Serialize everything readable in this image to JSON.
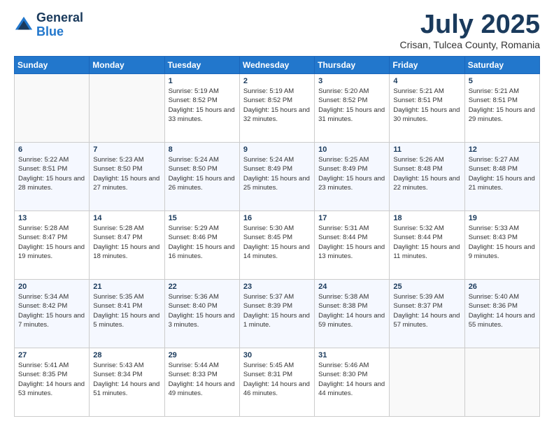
{
  "header": {
    "logo_line1": "General",
    "logo_line2": "Blue",
    "month_title": "July 2025",
    "location": "Crisan, Tulcea County, Romania"
  },
  "days_of_week": [
    "Sunday",
    "Monday",
    "Tuesday",
    "Wednesday",
    "Thursday",
    "Friday",
    "Saturday"
  ],
  "weeks": [
    [
      {
        "day": "",
        "sunrise": "",
        "sunset": "",
        "daylight": ""
      },
      {
        "day": "",
        "sunrise": "",
        "sunset": "",
        "daylight": ""
      },
      {
        "day": "1",
        "sunrise": "Sunrise: 5:19 AM",
        "sunset": "Sunset: 8:52 PM",
        "daylight": "Daylight: 15 hours and 33 minutes."
      },
      {
        "day": "2",
        "sunrise": "Sunrise: 5:19 AM",
        "sunset": "Sunset: 8:52 PM",
        "daylight": "Daylight: 15 hours and 32 minutes."
      },
      {
        "day": "3",
        "sunrise": "Sunrise: 5:20 AM",
        "sunset": "Sunset: 8:52 PM",
        "daylight": "Daylight: 15 hours and 31 minutes."
      },
      {
        "day": "4",
        "sunrise": "Sunrise: 5:21 AM",
        "sunset": "Sunset: 8:51 PM",
        "daylight": "Daylight: 15 hours and 30 minutes."
      },
      {
        "day": "5",
        "sunrise": "Sunrise: 5:21 AM",
        "sunset": "Sunset: 8:51 PM",
        "daylight": "Daylight: 15 hours and 29 minutes."
      }
    ],
    [
      {
        "day": "6",
        "sunrise": "Sunrise: 5:22 AM",
        "sunset": "Sunset: 8:51 PM",
        "daylight": "Daylight: 15 hours and 28 minutes."
      },
      {
        "day": "7",
        "sunrise": "Sunrise: 5:23 AM",
        "sunset": "Sunset: 8:50 PM",
        "daylight": "Daylight: 15 hours and 27 minutes."
      },
      {
        "day": "8",
        "sunrise": "Sunrise: 5:24 AM",
        "sunset": "Sunset: 8:50 PM",
        "daylight": "Daylight: 15 hours and 26 minutes."
      },
      {
        "day": "9",
        "sunrise": "Sunrise: 5:24 AM",
        "sunset": "Sunset: 8:49 PM",
        "daylight": "Daylight: 15 hours and 25 minutes."
      },
      {
        "day": "10",
        "sunrise": "Sunrise: 5:25 AM",
        "sunset": "Sunset: 8:49 PM",
        "daylight": "Daylight: 15 hours and 23 minutes."
      },
      {
        "day": "11",
        "sunrise": "Sunrise: 5:26 AM",
        "sunset": "Sunset: 8:48 PM",
        "daylight": "Daylight: 15 hours and 22 minutes."
      },
      {
        "day": "12",
        "sunrise": "Sunrise: 5:27 AM",
        "sunset": "Sunset: 8:48 PM",
        "daylight": "Daylight: 15 hours and 21 minutes."
      }
    ],
    [
      {
        "day": "13",
        "sunrise": "Sunrise: 5:28 AM",
        "sunset": "Sunset: 8:47 PM",
        "daylight": "Daylight: 15 hours and 19 minutes."
      },
      {
        "day": "14",
        "sunrise": "Sunrise: 5:28 AM",
        "sunset": "Sunset: 8:47 PM",
        "daylight": "Daylight: 15 hours and 18 minutes."
      },
      {
        "day": "15",
        "sunrise": "Sunrise: 5:29 AM",
        "sunset": "Sunset: 8:46 PM",
        "daylight": "Daylight: 15 hours and 16 minutes."
      },
      {
        "day": "16",
        "sunrise": "Sunrise: 5:30 AM",
        "sunset": "Sunset: 8:45 PM",
        "daylight": "Daylight: 15 hours and 14 minutes."
      },
      {
        "day": "17",
        "sunrise": "Sunrise: 5:31 AM",
        "sunset": "Sunset: 8:44 PM",
        "daylight": "Daylight: 15 hours and 13 minutes."
      },
      {
        "day": "18",
        "sunrise": "Sunrise: 5:32 AM",
        "sunset": "Sunset: 8:44 PM",
        "daylight": "Daylight: 15 hours and 11 minutes."
      },
      {
        "day": "19",
        "sunrise": "Sunrise: 5:33 AM",
        "sunset": "Sunset: 8:43 PM",
        "daylight": "Daylight: 15 hours and 9 minutes."
      }
    ],
    [
      {
        "day": "20",
        "sunrise": "Sunrise: 5:34 AM",
        "sunset": "Sunset: 8:42 PM",
        "daylight": "Daylight: 15 hours and 7 minutes."
      },
      {
        "day": "21",
        "sunrise": "Sunrise: 5:35 AM",
        "sunset": "Sunset: 8:41 PM",
        "daylight": "Daylight: 15 hours and 5 minutes."
      },
      {
        "day": "22",
        "sunrise": "Sunrise: 5:36 AM",
        "sunset": "Sunset: 8:40 PM",
        "daylight": "Daylight: 15 hours and 3 minutes."
      },
      {
        "day": "23",
        "sunrise": "Sunrise: 5:37 AM",
        "sunset": "Sunset: 8:39 PM",
        "daylight": "Daylight: 15 hours and 1 minute."
      },
      {
        "day": "24",
        "sunrise": "Sunrise: 5:38 AM",
        "sunset": "Sunset: 8:38 PM",
        "daylight": "Daylight: 14 hours and 59 minutes."
      },
      {
        "day": "25",
        "sunrise": "Sunrise: 5:39 AM",
        "sunset": "Sunset: 8:37 PM",
        "daylight": "Daylight: 14 hours and 57 minutes."
      },
      {
        "day": "26",
        "sunrise": "Sunrise: 5:40 AM",
        "sunset": "Sunset: 8:36 PM",
        "daylight": "Daylight: 14 hours and 55 minutes."
      }
    ],
    [
      {
        "day": "27",
        "sunrise": "Sunrise: 5:41 AM",
        "sunset": "Sunset: 8:35 PM",
        "daylight": "Daylight: 14 hours and 53 minutes."
      },
      {
        "day": "28",
        "sunrise": "Sunrise: 5:43 AM",
        "sunset": "Sunset: 8:34 PM",
        "daylight": "Daylight: 14 hours and 51 minutes."
      },
      {
        "day": "29",
        "sunrise": "Sunrise: 5:44 AM",
        "sunset": "Sunset: 8:33 PM",
        "daylight": "Daylight: 14 hours and 49 minutes."
      },
      {
        "day": "30",
        "sunrise": "Sunrise: 5:45 AM",
        "sunset": "Sunset: 8:31 PM",
        "daylight": "Daylight: 14 hours and 46 minutes."
      },
      {
        "day": "31",
        "sunrise": "Sunrise: 5:46 AM",
        "sunset": "Sunset: 8:30 PM",
        "daylight": "Daylight: 14 hours and 44 minutes."
      },
      {
        "day": "",
        "sunrise": "",
        "sunset": "",
        "daylight": ""
      },
      {
        "day": "",
        "sunrise": "",
        "sunset": "",
        "daylight": ""
      }
    ]
  ]
}
